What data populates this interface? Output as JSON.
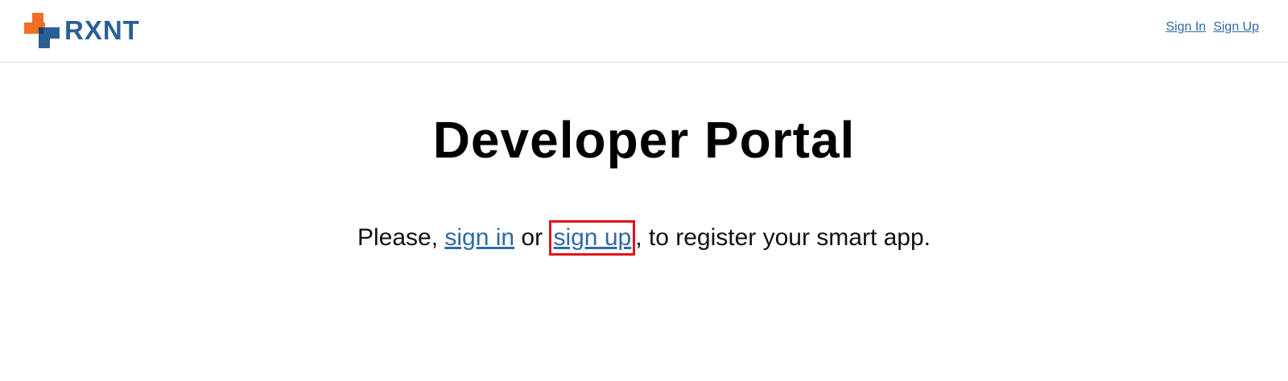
{
  "header": {
    "logo_text": "RXNT",
    "sign_in_label": "Sign In",
    "sign_up_label": "Sign Up"
  },
  "main": {
    "title": "Developer Portal",
    "message_prefix": "Please, ",
    "sign_in_link": "sign in",
    "message_or": " or ",
    "sign_up_link": "sign up",
    "message_suffix": ", to register your smart app."
  },
  "colors": {
    "logo_orange": "#f26f21",
    "logo_blue": "#2a5f96",
    "link": "#2f6aa6",
    "highlight": "#e0141e"
  },
  "icons": {
    "logo": "rxnt-cross-logo-icon"
  }
}
